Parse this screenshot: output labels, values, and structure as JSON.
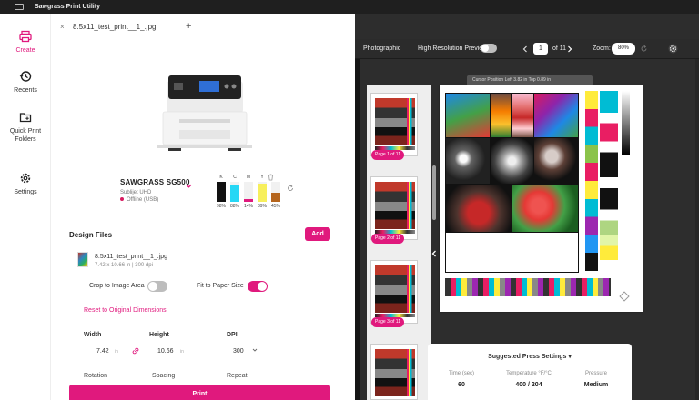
{
  "window": {
    "title": "Sawgrass Print Utility"
  },
  "nav": {
    "items": [
      {
        "label": "Create",
        "icon": "printer-icon",
        "active": true
      },
      {
        "label": "Recents",
        "icon": "history-icon",
        "active": false
      },
      {
        "label": "Quick Print Folders",
        "icon": "folder-icon",
        "active": false
      },
      {
        "label": "Settings",
        "icon": "gear-icon",
        "active": false
      }
    ]
  },
  "tabs": {
    "close": "×",
    "title": "8.5x11_test_print__1_.jpg",
    "add": "+"
  },
  "printer": {
    "name": "SAWGRASS SG500",
    "ink_type": "Sublijet UHD",
    "status": "Offline (USB)",
    "inks": [
      {
        "label": "K",
        "percent": "98%",
        "level": 0.98,
        "color": "#111111"
      },
      {
        "label": "C",
        "percent": "88%",
        "level": 0.88,
        "color": "#26d7f5"
      },
      {
        "label": "M",
        "percent": "14%",
        "level": 0.14,
        "color": "#e0197d"
      },
      {
        "label": "Y",
        "percent": "89%",
        "level": 0.89,
        "color": "#f7ef5c"
      },
      {
        "label": "",
        "percent": "45%",
        "level": 0.45,
        "color": "#b5651d"
      }
    ]
  },
  "design": {
    "section_title": "Design Files",
    "add_label": "Add",
    "file_name": "8.5x11_test_print__1_.jpg",
    "file_meta": "7.42 x 10.66 in | 300 dpi",
    "crop_label": "Crop to Image Area",
    "fit_label": "Fit to Paper Size",
    "reset_label": "Reset to Dimensions",
    "reset_text": "Reset to Original Dimensions",
    "width_label": "Width",
    "width_value": "7.42",
    "height_label": "Height",
    "height_value": "10.66",
    "unit": "in",
    "dpi_label": "DPI",
    "dpi_value": "300",
    "rotation_label": "Rotation",
    "spacing_label": "Spacing",
    "repeat_label": "Repeat",
    "print_label": "Print"
  },
  "preview": {
    "mode": "Photographic",
    "hires_label": "High Resolution Preview",
    "page": "1",
    "of_pages": "of  11",
    "zoom_label": "Zoom:",
    "zoom_value": "80%",
    "cursor_text": "Cursor Position   Left  3.82 in   Top  0.89 in",
    "thumbnails": [
      {
        "label": "Page 1 of 11"
      },
      {
        "label": "Page 2 of 11"
      },
      {
        "label": "Page 3 of 11"
      }
    ]
  },
  "press": {
    "title": "Suggested Press Settings ▾",
    "time_label": "Time (sec)",
    "time_value": "60",
    "temp_label": "Temperature °F/°C",
    "temp_value": "400 / 204",
    "pressure_label": "Pressure",
    "pressure_value": "Medium"
  }
}
